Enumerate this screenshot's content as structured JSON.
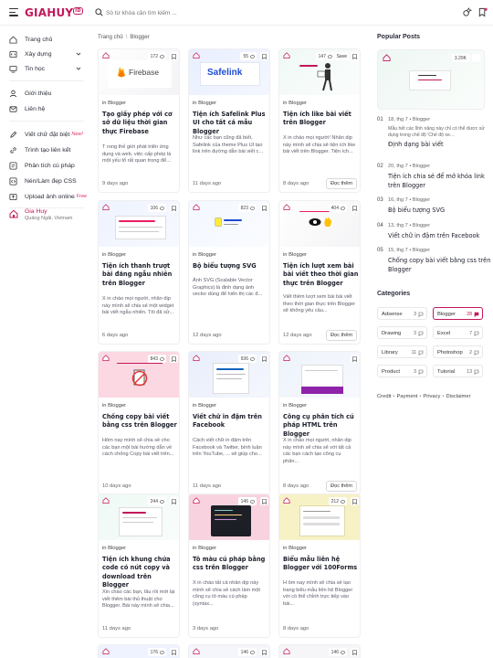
{
  "header": {
    "logo": "GIAHUY",
    "logo_sup": "ID",
    "search_placeholder": "Sö từ khóa cần tìm kiếm ..."
  },
  "sidebar": {
    "items": [
      {
        "label": "Trang chủ",
        "icon": "home-icon"
      },
      {
        "label": "Xây dựng",
        "icon": "code-icon",
        "dropdown": true
      },
      {
        "label": "Tin học",
        "icon": "monitor-icon",
        "dropdown": true
      },
      {
        "label": "Giới thiệu",
        "icon": "user-icon"
      },
      {
        "label": "Liên hệ",
        "icon": "mail-icon"
      },
      {
        "label": "Viết chữ đặt biệt",
        "badge": "New!",
        "icon": "edit-icon"
      },
      {
        "label": "Trình tạo liên kết",
        "icon": "link-icon"
      },
      {
        "label": "Phân tích cú pháp",
        "icon": "parse-icon"
      },
      {
        "label": "Nén/Làm đẹp CSS",
        "icon": "css-icon"
      },
      {
        "label": "Upload ảnh online",
        "badge": "Free",
        "icon": "upload-icon"
      }
    ],
    "profile": {
      "name": "Gia Huy",
      "location": "Quảng Ngãi, Vietnam"
    }
  },
  "breadcrumb": {
    "home": "Trang chủ",
    "sep": "\\",
    "current": "Blogger"
  },
  "cards": [
    {
      "views": "172",
      "category": "in Blogger",
      "title": "Tạo giấy phép với cơ sở dữ liệu thời gian thực Firebase",
      "excerpt": "T rong thế giới phát triển ứng dụng và web, việc cấp phép là một yếu tố rất quan trọng để...",
      "date": "9 days ago",
      "thumb_text": "Firebase"
    },
    {
      "views": "55",
      "category": "in Blogger",
      "title": "Tiện ích Safelink Plus UI cho tất cả mẫu Blogger",
      "excerpt": "Như các bạn cũng đã biết, Safelink của theme Plus UI tạo link trên đường dẫn bài viết c...",
      "date": "11 days ago",
      "thumb_text": "Safelink"
    },
    {
      "views": "147",
      "save": "Save",
      "category": "in Blogger",
      "title": "Tiện ích like bài viết trên Blogger",
      "excerpt": "X in chào mọi người! Nhân dịp này mình sẽ chia sẻ tiện ích like bài viết trên Blogger. Tiện ích...",
      "date": "8 days ago",
      "readmore": "Đọc thêm"
    },
    {
      "views": "106",
      "category": "in Blogger",
      "title": "Tiện ích thanh trượt bài đăng ngẫu nhiên trên Blogger",
      "excerpt": "X in chào mọi người, nhân dịp này mình sẽ chia sẻ một widget bài viết ngẫu nhiên. Tôi đã sử...",
      "date": "6 days ago"
    },
    {
      "views": "823",
      "category": "in Blogger",
      "title": "Bộ biểu tượng SVG",
      "excerpt": "Ảnh SVG (Scalable Vector Graphics) là định dạng ảnh vector dùng để hiển thị các đ...",
      "date": "12 days ago"
    },
    {
      "views": "404",
      "category": "in Blogger",
      "title": "Tiện ích lượt xem bài bài viết theo thời gian thực trên Blogger",
      "excerpt": "Viết thêm lượt xem bài bài viết theo thời gian thực trên Blogger sẽ không yêu cầu...",
      "date": "12 days ago",
      "readmore": "Đọc thêm"
    },
    {
      "views": "843",
      "category": "in Blogger",
      "title": "Chống copy bài viết bằng css trên Blogger",
      "excerpt": "Hôm nay mình sẽ chia sẻ cho các bạn một bài hướng dẫn về cách chống Copy bài viết trên...",
      "date": "10 days ago"
    },
    {
      "views": "936",
      "category": "in Blogger",
      "title": "Viết chữ in đậm trên Facebook",
      "excerpt": "Cách viết chữ in đậm trên Facebook và Twitter, bình luận trên YouTube, ... sẽ giúp cho...",
      "date": "11 days ago"
    },
    {
      "views": "",
      "category": "in Blogger",
      "title": "Công cụ phân tích cú pháp HTML trên Blogger",
      "excerpt": "X in chào mọi người, nhân dịp này mình sẽ chia sẻ với tất cả các bạn cách tạo công cụ phân...",
      "date": "8 days ago",
      "readmore": "Đọc thêm"
    },
    {
      "views": "244",
      "category": "in Blogger",
      "title": "Tiện ích khung chứa code có nút copy và download trên Blogger",
      "excerpt": "Xin chào các bạn, lâu rồi mới lại viết thêm bài thủ thuật cho Blogger. Bài này mình sẽ chia...",
      "date": "11 days ago"
    },
    {
      "views": "146",
      "category": "in Blogger",
      "title": "Tô màu cú pháp bằng css trên Blogger",
      "excerpt": "X in chào tất cả nhân dịp này mình sẽ chia sẻ cách làm một công cụ tô màu cú pháp (syntax...",
      "date": "3 days ago"
    },
    {
      "views": "212",
      "category": "in Blogger",
      "title": "Biểu mẫu liên hệ Blogger với 100Forms",
      "excerpt": "H ôm nay mình sẽ chia sẻ tạo trang biểu mẫu liên hệ Blogger với có thể chỉnh trực tiếp vào bài...",
      "date": "8 days ago"
    },
    {
      "views": "176"
    },
    {
      "views": "146"
    },
    {
      "views": "146"
    }
  ],
  "popular": {
    "heading": "Popular Posts",
    "top_views": "3.29K",
    "items": [
      {
        "no": "01",
        "date": "18, thg 7",
        "cat": "Blogger",
        "excerpt": "Mẫu hết các lĩnh năng này chỉ có thể được sử dụng trong chế độ 'Chế độ xe...",
        "title": "Định dạng bài viết"
      },
      {
        "no": "02",
        "date": "20, thg 7",
        "cat": "Blogger",
        "title": "Tiện ích chia sẻ để mở khóa link trên Blogger"
      },
      {
        "no": "03",
        "date": "16, thg 7",
        "cat": "Blogger",
        "title": "Bộ biểu tượng SVG"
      },
      {
        "no": "04",
        "date": "13, thg 7",
        "cat": "Blogger",
        "title": "Viết chữ in đậm trên Facebook"
      },
      {
        "no": "05",
        "date": "15, thg 7",
        "cat": "Blogger",
        "title": "Chống copy bài viết bằng css trên Blogger"
      }
    ]
  },
  "categories": {
    "heading": "Categories",
    "items": [
      {
        "name": "Adsense",
        "count": "3"
      },
      {
        "name": "Blogger",
        "count": "28",
        "active": true
      },
      {
        "name": "Drawing",
        "count": "3"
      },
      {
        "name": "Excel",
        "count": "7"
      },
      {
        "name": "Library",
        "count": "11"
      },
      {
        "name": "Photoshop",
        "count": "2"
      },
      {
        "name": "Product",
        "count": "3"
      },
      {
        "name": "Tutorial",
        "count": "13"
      }
    ]
  },
  "footer": {
    "links": [
      "Credit",
      "Payment",
      "Privacy",
      "Disclaimer"
    ]
  },
  "colors": {
    "brand": "#c2185b",
    "accent_pink": "#e0306a"
  }
}
